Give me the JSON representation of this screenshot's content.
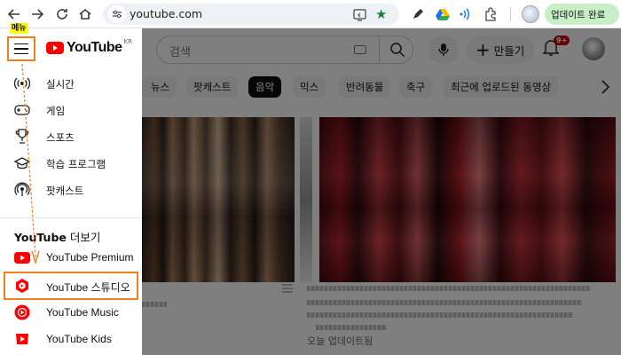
{
  "browser": {
    "url": "youtube.com",
    "update_label": "업데이트 완료",
    "icons": [
      "back-icon",
      "forward-icon",
      "reload-icon",
      "home-icon",
      "site-settings-icon",
      "cast-icon",
      "bookmark-star-icon",
      "pen-icon",
      "drive-icon",
      "wifi-icon",
      "extensions-icon",
      "profile-icon"
    ]
  },
  "youtube": {
    "logo_text": "YouTube",
    "country_code": "KR",
    "search_placeholder": "검색",
    "create_label": "만들기",
    "notification_count": "9+",
    "chips": [
      "뉴스",
      "팟캐스트",
      "음악",
      "믹스",
      "반려동물",
      "축구",
      "최근에 업로드된 동영상"
    ],
    "active_chip": "음악",
    "updated_label": "오늘 업데이트됨"
  },
  "drawer": {
    "menu_tag": "메뉴",
    "explore_items": [
      {
        "label": "실시간",
        "icon": "live-icon"
      },
      {
        "label": "게임",
        "icon": "gaming-icon"
      },
      {
        "label": "스포츠",
        "icon": "trophy-icon"
      },
      {
        "label": "학습 프로그램",
        "icon": "graduation-cap-icon"
      },
      {
        "label": "팟캐스트",
        "icon": "podcast-icon"
      }
    ],
    "more_title_brand": "YouTube",
    "more_title_suffix": " 더보기",
    "more_items": [
      {
        "label": "YouTube Premium",
        "icon": "youtube-premium-icon"
      },
      {
        "label": "YouTube 스튜디오",
        "icon": "youtube-studio-icon"
      },
      {
        "label": "YouTube Music",
        "icon": "youtube-music-icon"
      },
      {
        "label": "YouTube Kids",
        "icon": "youtube-kids-icon"
      }
    ],
    "highlighted_item": "YouTube 스튜디오"
  },
  "colors": {
    "annotation_orange": "#f07f1e",
    "tag_yellow": "#ffff00",
    "youtube_red": "#ff0000",
    "update_green": "#c8f0c8"
  }
}
